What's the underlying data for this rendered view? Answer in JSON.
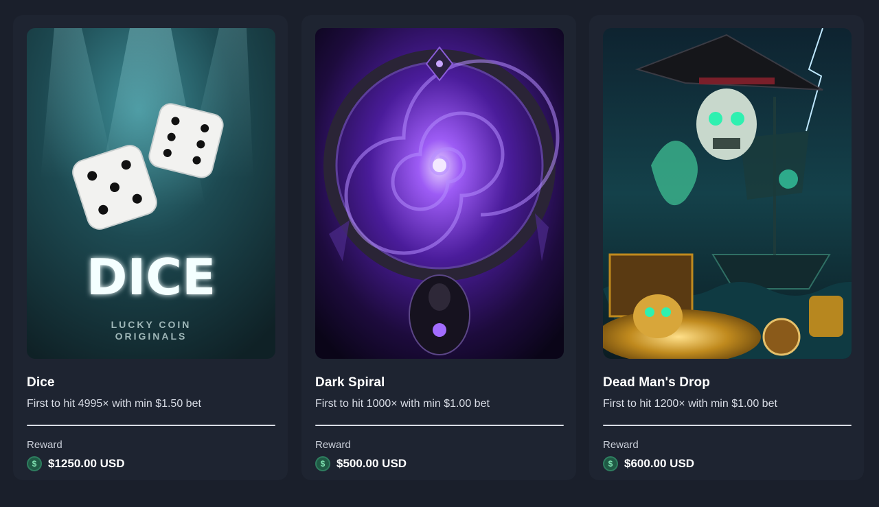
{
  "cards": [
    {
      "title": "Dice",
      "description": "First to hit 4995× with min $1.50 bet",
      "reward_label": "Reward",
      "reward_amount": "$1250.00 USD",
      "art_text": "DICE",
      "art_subtext_1": "LUCKY COIN",
      "art_subtext_2": "ORIGINALS",
      "currency_symbol": "$"
    },
    {
      "title": "Dark Spiral",
      "description": "First to hit 1000× with min $1.00 bet",
      "reward_label": "Reward",
      "reward_amount": "$500.00 USD",
      "currency_symbol": "$"
    },
    {
      "title": "Dead Man's Drop",
      "description": "First to hit 1200× with min $1.00 bet",
      "reward_label": "Reward",
      "reward_amount": "$600.00 USD",
      "currency_symbol": "$"
    }
  ],
  "colors": {
    "background": "#1a1f2b",
    "card": "#1e2431",
    "coin": "#1f5a45",
    "dice_glow": "#2fb4c0",
    "spiral_purple": "#7b3fe4",
    "pirate_teal": "#2ad6b0"
  },
  "icons": {
    "coin": "dollar-coin-icon"
  }
}
